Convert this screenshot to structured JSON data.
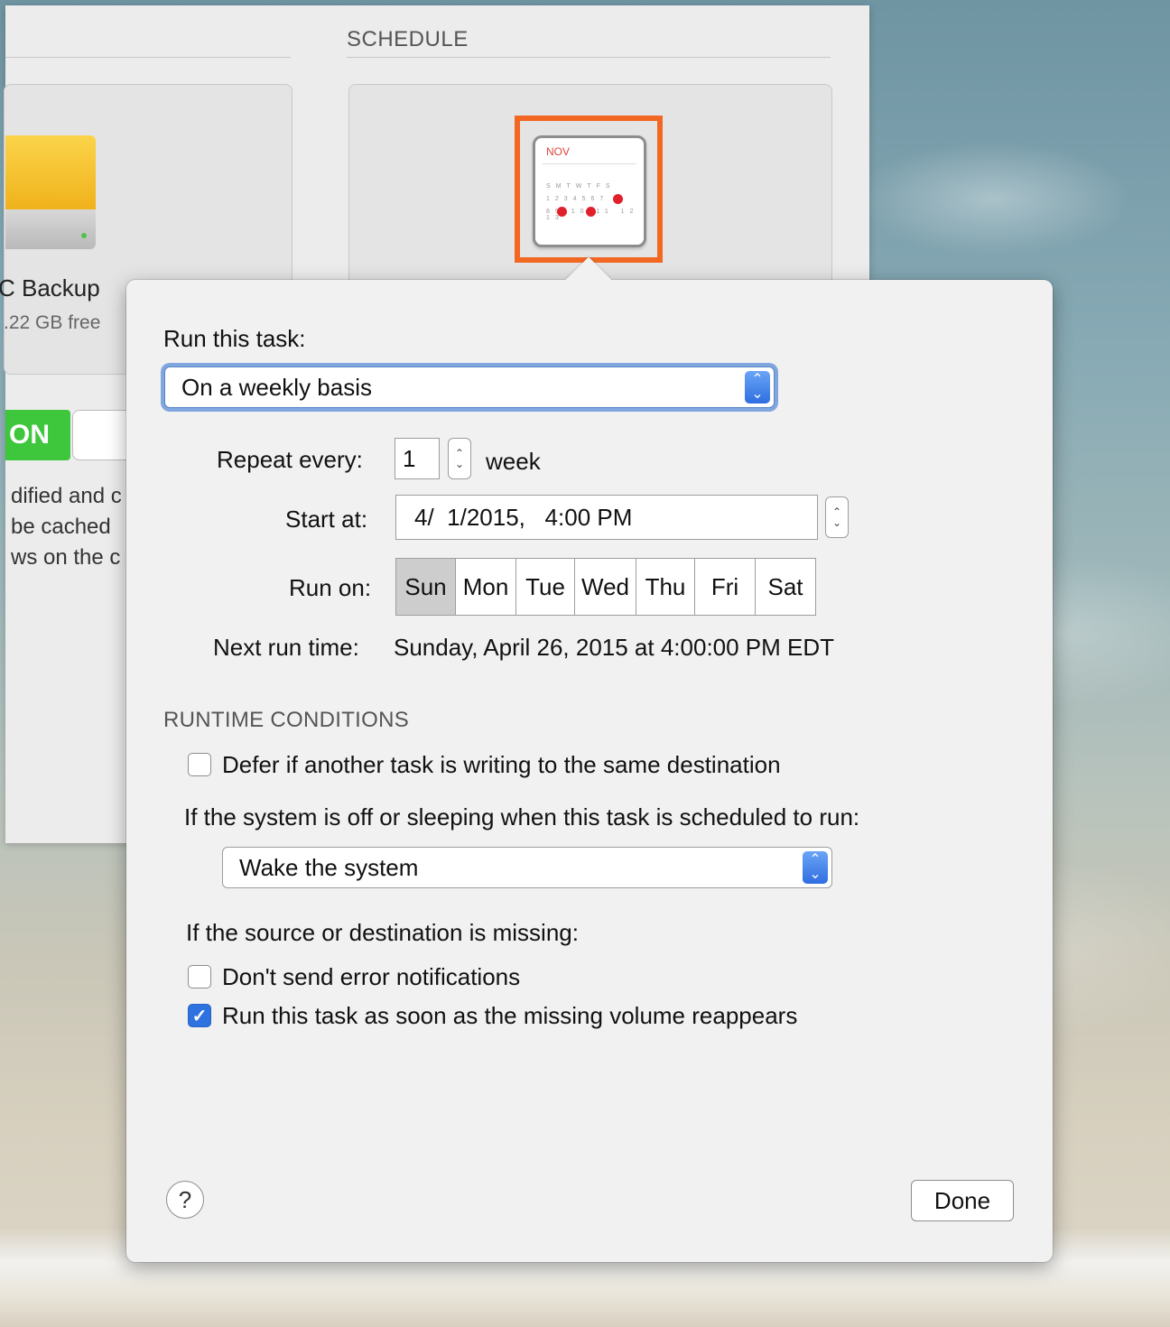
{
  "background_window": {
    "schedule_header": "SCHEDULE",
    "destination_name": "C Backup",
    "destination_free": ".22 GB free",
    "toggle_label": "ON",
    "description_lines": [
      "dified and c",
      " be cached",
      "ws on the c"
    ],
    "calendar_icon_month": "NOV"
  },
  "popover": {
    "run_label": "Run this task:",
    "run_select_value": "On a weekly basis",
    "repeat_label": "Repeat every:",
    "repeat_value": "1",
    "repeat_unit": "week",
    "start_label": "Start at:",
    "start_value": "4/  1/2015,   4:00 PM",
    "run_on_label": "Run on:",
    "days": [
      "Sun",
      "Mon",
      "Tue",
      "Wed",
      "Thu",
      "Fri",
      "Sat"
    ],
    "selected_day": "Sun",
    "next_run_label": "Next run time:",
    "next_run_value": "Sunday, April 26, 2015 at 4:00:00 PM EDT",
    "runtime_header": "RUNTIME CONDITIONS",
    "defer_label": "Defer if another task is writing to the same destination",
    "defer_checked": false,
    "sleep_label": "If the system is off or sleeping when this task is scheduled to run:",
    "sleep_select_value": "Wake the system",
    "missing_label": "If the source or destination is missing:",
    "no_error_label": "Don't send error notifications",
    "no_error_checked": false,
    "run_reappear_label": "Run this task as soon as the missing volume reappears",
    "run_reappear_checked": true,
    "help_label": "?",
    "done_label": "Done"
  },
  "colors": {
    "highlight": "#f26722",
    "toggle_on": "#3ec63d",
    "accent": "#2e72e0"
  }
}
